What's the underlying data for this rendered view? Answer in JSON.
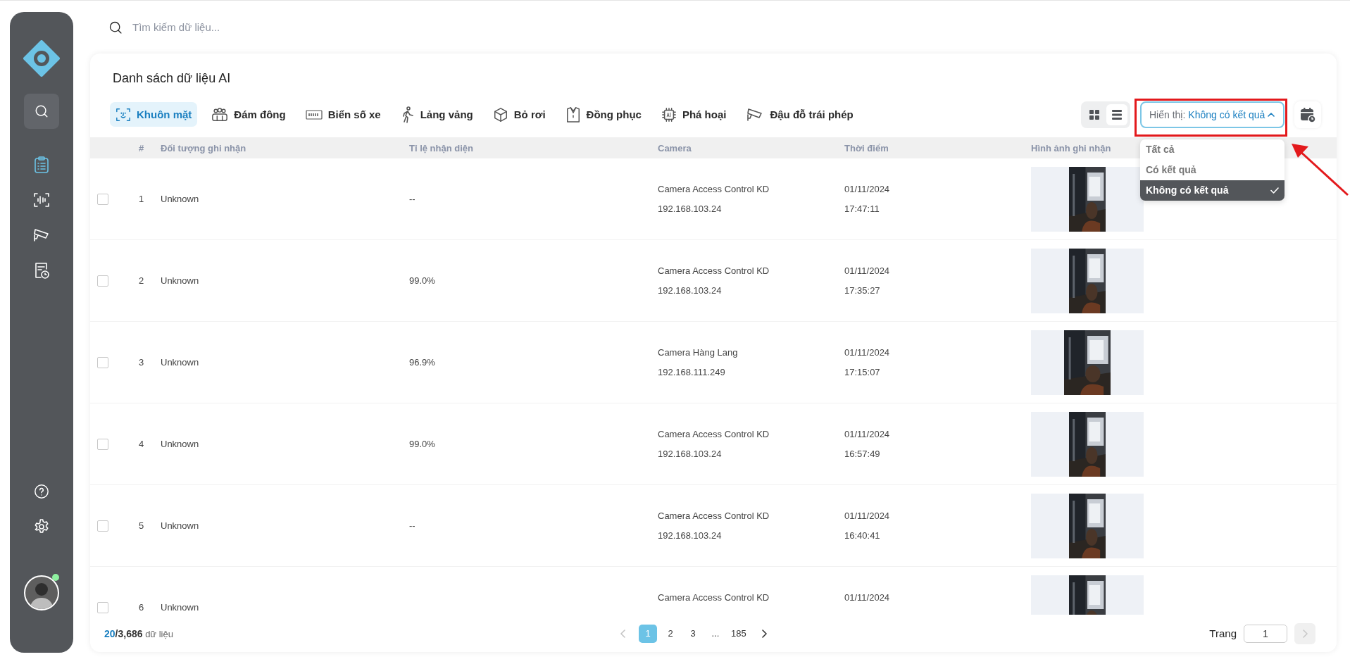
{
  "sidebar": {
    "nav_items": [
      {
        "selected": false
      },
      {
        "selected": true
      },
      {
        "selected": false
      },
      {
        "selected": false
      },
      {
        "selected": false
      }
    ],
    "avatar": {
      "online": true
    }
  },
  "search": {
    "placeholder": "Tìm kiếm dữ liệu..."
  },
  "card": {
    "title": "Danh sách dữ liệu AI",
    "tabs": [
      {
        "label": "Khuôn mặt",
        "selected": true
      },
      {
        "label": "Đám đông",
        "selected": false
      },
      {
        "label": "Biển số xe",
        "selected": false
      },
      {
        "label": "Lảng vảng",
        "selected": false
      },
      {
        "label": "Bỏ rơi",
        "selected": false
      },
      {
        "label": "Đồng phục",
        "selected": false
      },
      {
        "label": "Phá hoại",
        "selected": false
      },
      {
        "label": "Đậu đỗ trái phép",
        "selected": false
      }
    ],
    "view_toggle": [
      {
        "selected": false
      },
      {
        "selected": true
      }
    ],
    "filter": {
      "label": "Hiển thị:",
      "value": "Không có kết quả",
      "expanded": true,
      "options": [
        {
          "label": "Tất cả",
          "selected": false
        },
        {
          "label": "Có kết quả",
          "selected": false
        },
        {
          "label": "Không có kết quả",
          "selected": true
        }
      ]
    },
    "table": {
      "columns": [
        "#",
        "Đối tượng ghi nhận",
        "Tỉ lệ nhận diện",
        "Camera",
        "Thời điểm",
        "Hình ảnh ghi nhận"
      ],
      "rows": [
        {
          "checked": false,
          "number": "1",
          "subject": "Unknown",
          "rate": "--",
          "camera": "Camera Access Control KD",
          "ip": "192.168.103.24",
          "date": "01/11/2024",
          "time": "17:47:11"
        },
        {
          "checked": false,
          "number": "2",
          "subject": "Unknown",
          "rate": "99.0%",
          "camera": "Camera Access Control KD",
          "ip": "192.168.103.24",
          "date": "01/11/2024",
          "time": "17:35:27"
        },
        {
          "checked": false,
          "number": "3",
          "subject": "Unknown",
          "rate": "96.9%",
          "camera": "Camera Hàng Lang",
          "ip": "192.168.111.249",
          "date": "01/11/2024",
          "time": "17:15:07"
        },
        {
          "checked": false,
          "number": "4",
          "subject": "Unknown",
          "rate": "99.0%",
          "camera": "Camera Access Control KD",
          "ip": "192.168.103.24",
          "date": "01/11/2024",
          "time": "16:57:49"
        },
        {
          "checked": false,
          "number": "5",
          "subject": "Unknown",
          "rate": "--",
          "camera": "Camera Access Control KD",
          "ip": "192.168.103.24",
          "date": "01/11/2024",
          "time": "16:40:41"
        },
        {
          "checked": false,
          "number": "6",
          "subject": "Unknown",
          "camera": "Camera Access Control KD",
          "date": "01/11/2024"
        }
      ]
    },
    "footer": {
      "shown": "20",
      "total": "/3,686",
      "unit": "dữ liệu",
      "pages": [
        {
          "label": "1",
          "selected": true
        },
        {
          "label": "2",
          "selected": false
        },
        {
          "label": "3",
          "selected": false
        },
        {
          "label": "...",
          "selected": false
        },
        {
          "label": "185",
          "selected": false
        }
      ],
      "prev_disabled": true,
      "next_disabled": false,
      "page_label": "Trang",
      "page_value": "1",
      "go_disabled": true
    }
  }
}
